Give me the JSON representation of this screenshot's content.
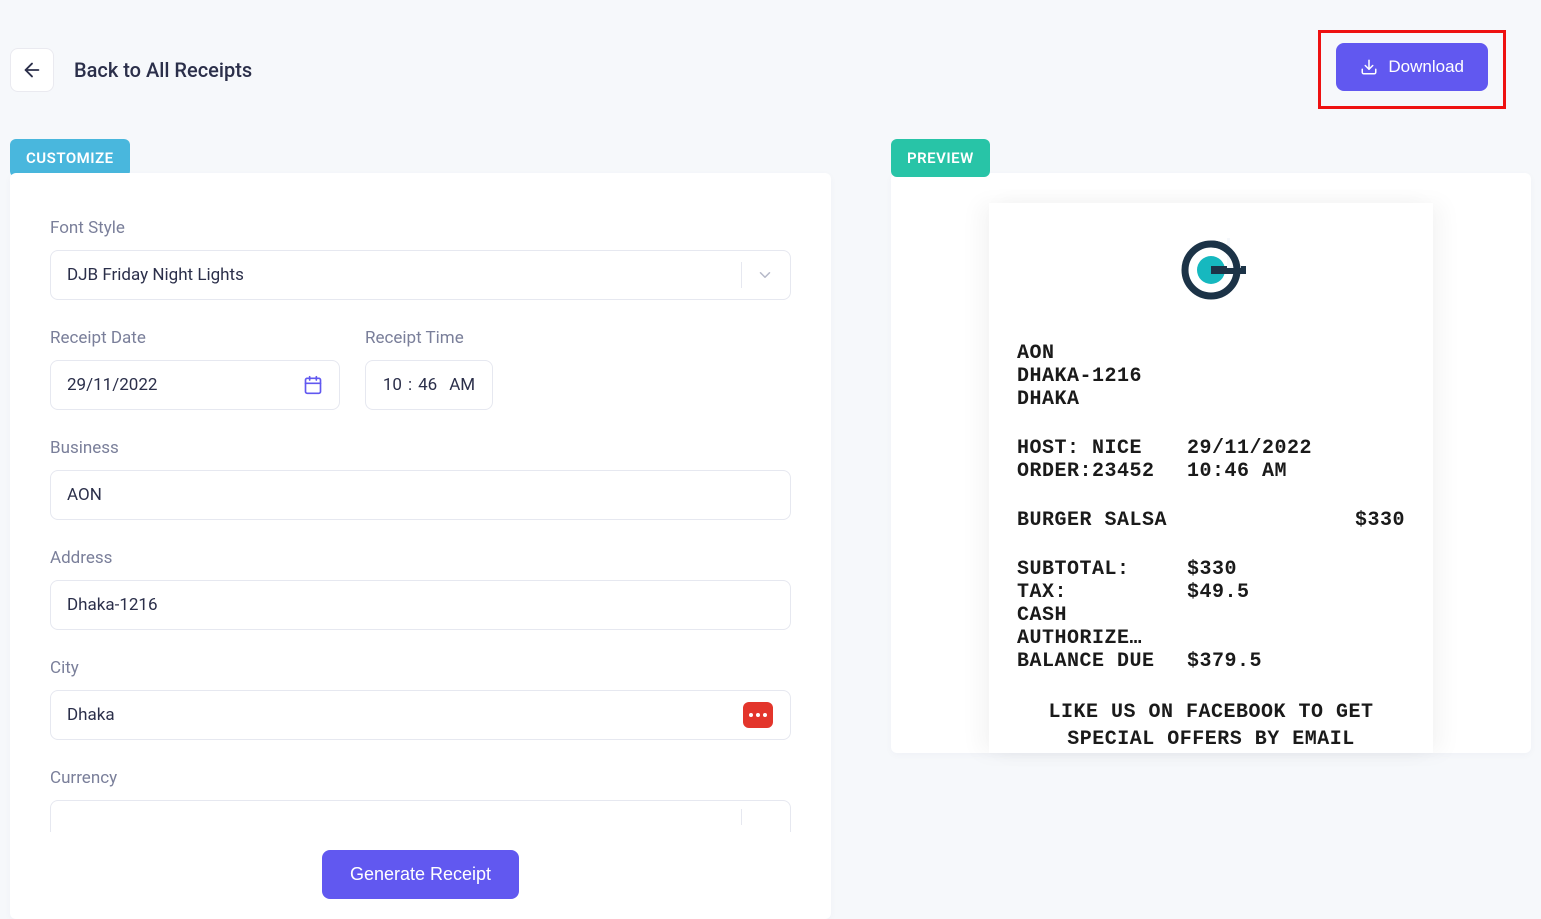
{
  "header": {
    "back_label": "Back to All Receipts",
    "download_label": "Download"
  },
  "tags": {
    "customize": "CUSTOMIZE",
    "preview": "PREVIEW"
  },
  "form": {
    "font_style_label": "Font Style",
    "font_style_value": "DJB Friday Night Lights",
    "receipt_date_label": "Receipt Date",
    "receipt_date_value": "29/11/2022",
    "receipt_time_label": "Receipt Time",
    "time_hour": "10",
    "time_minute": "46",
    "time_ampm": "AM",
    "business_label": "Business",
    "business_value": "AON",
    "address_label": "Address",
    "address_value": "Dhaka-1216",
    "city_label": "City",
    "city_value": "Dhaka",
    "currency_label": "Currency"
  },
  "buttons": {
    "generate": "Generate Receipt"
  },
  "receipt": {
    "company": "AON",
    "addr1": "DHAKA-1216",
    "addr2": "DHAKA",
    "host_label": "HOST:",
    "host_value": "NICE",
    "order_label": "ORDER:",
    "order_value": "23452",
    "date": "29/11/2022",
    "time": "10:46 AM",
    "item_name": "BURGER SALSA",
    "item_price": "$330",
    "subtotal_label": "SUBTOTAL:",
    "subtotal_value": "$330",
    "tax_label": "TAX:",
    "tax_value": "$49.5",
    "cash_label": "CASH",
    "authorize_label": "AUTHORIZE…",
    "balance_label": "BALANCE DUE",
    "balance_value": "$379.5",
    "footer1": "LIKE US ON FACEBOOK TO GET",
    "footer2": "SPECIAL OFFERS BY EMAIL"
  }
}
